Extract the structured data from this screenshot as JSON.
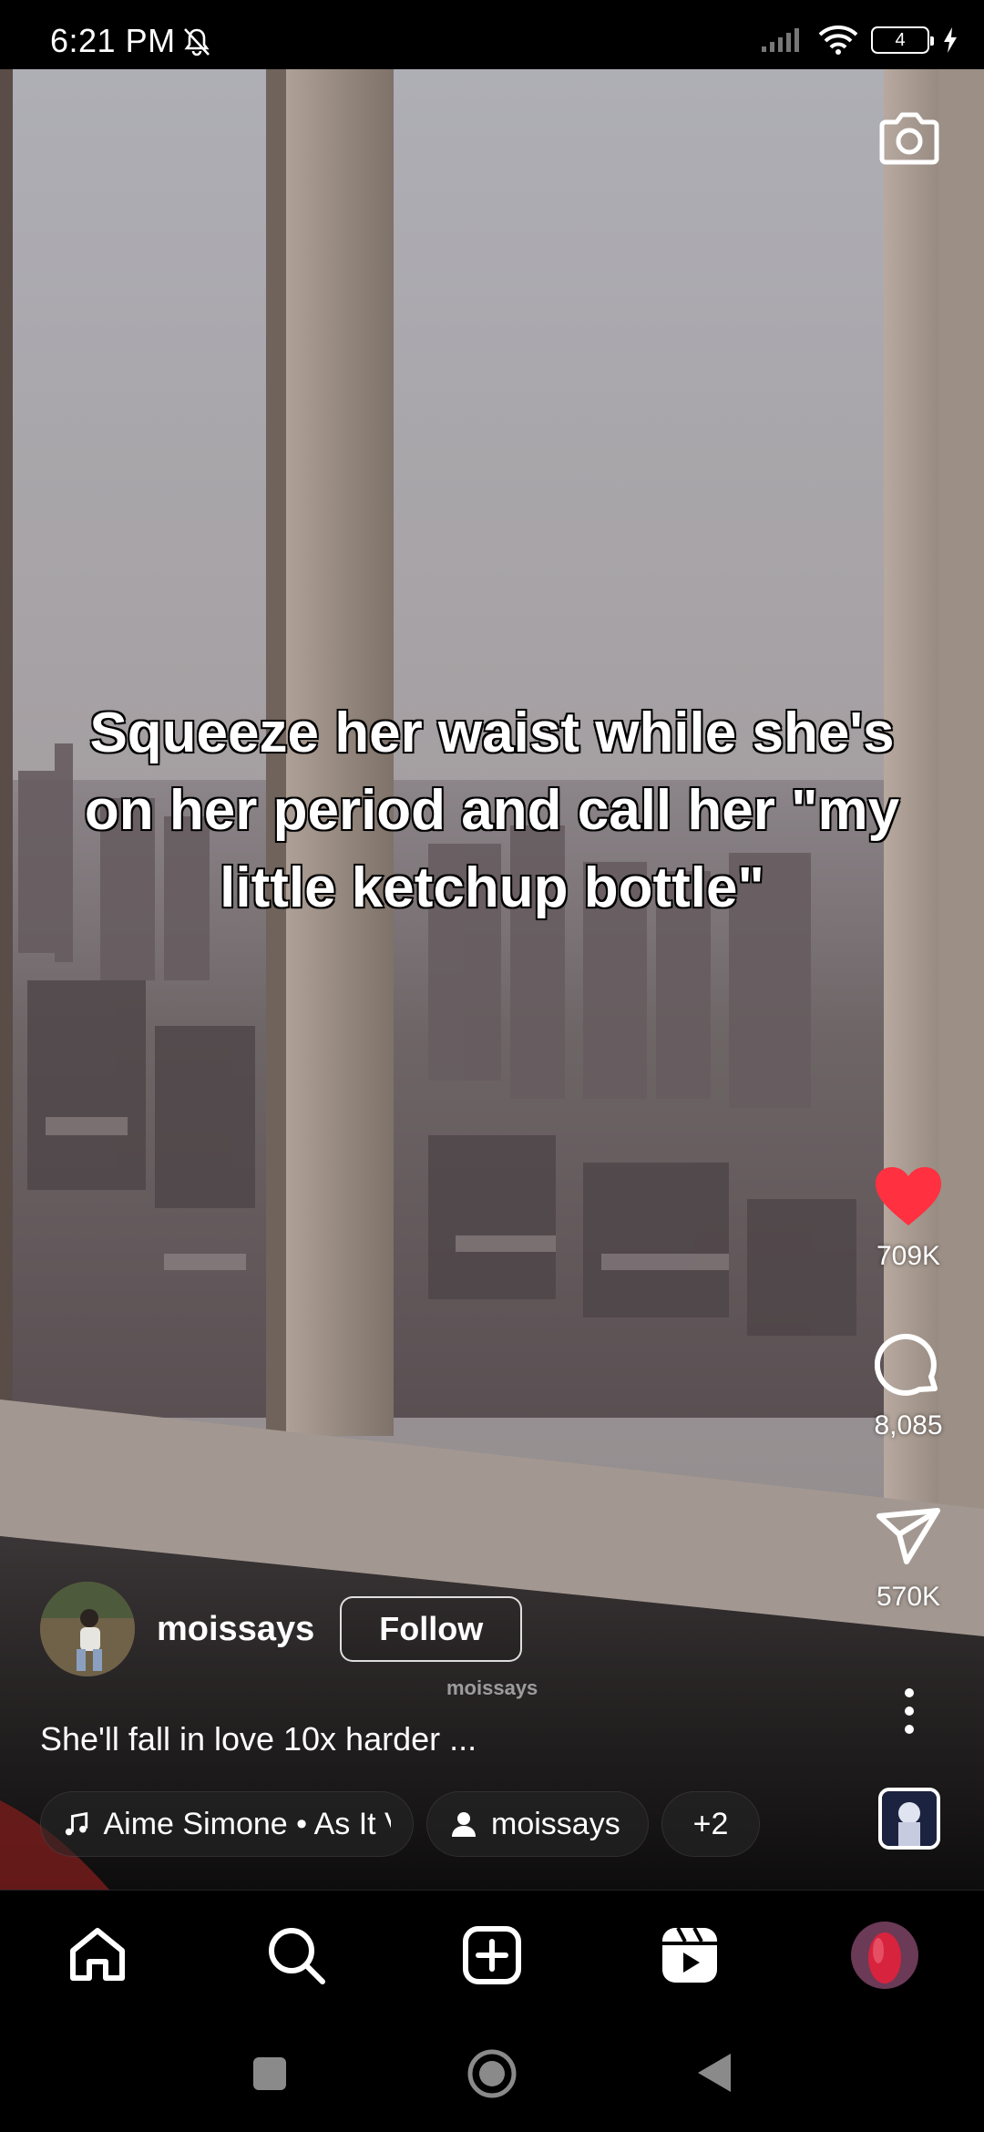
{
  "status_bar": {
    "time": "6:21 PM",
    "battery": "4",
    "icons": [
      "mute-bell-icon",
      "signal-icon",
      "wifi-icon",
      "battery-icon",
      "charging-icon"
    ]
  },
  "overlay_text": "Squeeze her waist while she's on her period and call her \"my little ketchup bottle\"",
  "watermark": "moissays",
  "actions": {
    "likes": "709K",
    "comments": "8,085",
    "shares": "570K",
    "like_color": "#ff3040"
  },
  "author": {
    "username": "moissays",
    "follow_label": "Follow"
  },
  "caption": "She'll fall in love 10x harder ...",
  "chips": {
    "music": "Aime Simone • As It V",
    "user": "moissays",
    "more": "+2"
  },
  "bottom_nav": [
    "home-icon",
    "search-icon",
    "create-icon",
    "reels-icon",
    "profile-avatar"
  ]
}
